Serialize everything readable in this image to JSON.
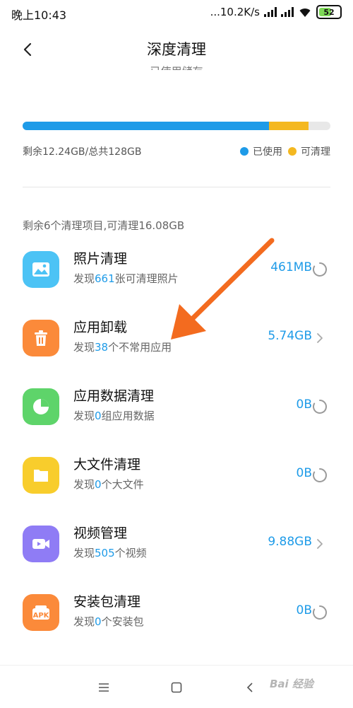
{
  "status_bar": {
    "time": "晚上10:43",
    "speed": "...10.2K/s",
    "battery": "52"
  },
  "header": {
    "title": "深度清理",
    "clipped_label": "已使用储存"
  },
  "storage": {
    "used_fraction": 0.8,
    "cleanable_fraction": 0.13,
    "summary": "剩余12.24GB/总共128GB",
    "legend_used": "已使用",
    "legend_cleanable": "可清理",
    "colors": {
      "used": "#1e9be8",
      "cleanable": "#f4b820",
      "track": "#e8e8e8"
    }
  },
  "list_summary": "剩余6个清理项目,可清理16.08GB",
  "items": [
    {
      "title": "照片清理",
      "desc_prefix": "发现",
      "desc_num": "661",
      "desc_suffix": "张可清理照片",
      "size": "461MB",
      "trail": "spinner-icon",
      "icon": "photo-icon",
      "color": "#4cc3f5"
    },
    {
      "title": "应用卸载",
      "desc_prefix": "发现",
      "desc_num": "38",
      "desc_suffix": "个不常用应用",
      "size": "5.74GB",
      "trail": "chevron-right-icon",
      "icon": "trash-icon",
      "color": "#fb8a3a"
    },
    {
      "title": "应用数据清理",
      "desc_prefix": "发现",
      "desc_num": "0",
      "desc_suffix": "组应用数据",
      "size": "0B",
      "trail": "spinner-icon",
      "icon": "pie-chart-icon",
      "color": "#5ed46a"
    },
    {
      "title": "大文件清理",
      "desc_prefix": "发现",
      "desc_num": "0",
      "desc_suffix": "个大文件",
      "size": "0B",
      "trail": "spinner-icon",
      "icon": "folder-icon",
      "color": "#f8cd2c"
    },
    {
      "title": "视频管理",
      "desc_prefix": "发现",
      "desc_num": "505",
      "desc_suffix": "个视频",
      "size": "9.88GB",
      "trail": "chevron-right-icon",
      "icon": "video-icon",
      "color": "#8f7cf5"
    },
    {
      "title": "安装包清理",
      "desc_prefix": "发现",
      "desc_num": "0",
      "desc_suffix": "个安装包",
      "size": "0B",
      "trail": "spinner-icon",
      "icon": "apk-icon",
      "color": "#fb8a3a",
      "icon_text": "APK"
    }
  ],
  "watermark": "Bai 经验"
}
